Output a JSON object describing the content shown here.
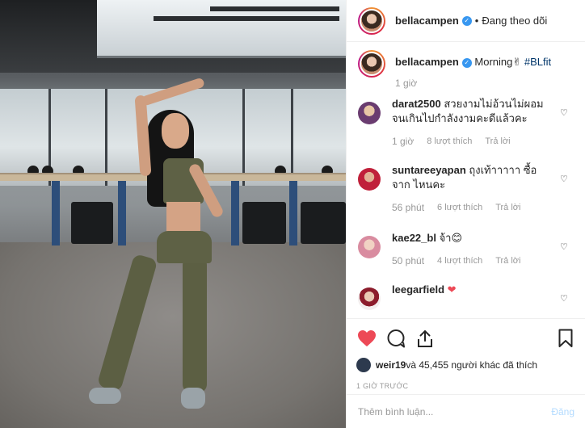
{
  "post": {
    "username": "bellacampen",
    "follow_status": "Đang theo dõi",
    "caption_text": "Morning",
    "caption_emoji": "✌",
    "caption_tag": "#BLfit",
    "caption_time": "1 giờ"
  },
  "comments": [
    {
      "user": "darat2500",
      "text": "สวยงามไม่อ้วนไม่ผอม จนเกินไปกำลังงามคะดีแล้วคะ",
      "time": "1 giờ",
      "likes": "8 lượt thích",
      "reply": "Trả lời"
    },
    {
      "user": "suntareeyapan",
      "text": "ถุงเท้าาาาา ซื้อจาก ไหนคะ",
      "time": "56 phút",
      "likes": "6 lượt thích",
      "reply": "Trả lời"
    },
    {
      "user": "kae22_bl",
      "text": "จ้า😊",
      "time": "50 phút",
      "likes": "4 lượt thích",
      "reply": "Trả lời"
    },
    {
      "user": "leegarfield",
      "text": "❤",
      "time": "",
      "likes": "",
      "reply": ""
    }
  ],
  "likes": {
    "user": "weir19",
    "rest": " và 45,455 người khác đã thích"
  },
  "posted_ago": "1 GIỜ TRƯỚC",
  "add_comment": {
    "placeholder": "Thêm bình luận...",
    "post_label": "Đăng"
  },
  "colors": {
    "like_red": "#ed4956",
    "verified_blue": "#3897f0",
    "hashtag": "#003569"
  },
  "icons": [
    "verified-icon",
    "heart-icon",
    "comment-icon",
    "share-icon",
    "bookmark-icon"
  ]
}
